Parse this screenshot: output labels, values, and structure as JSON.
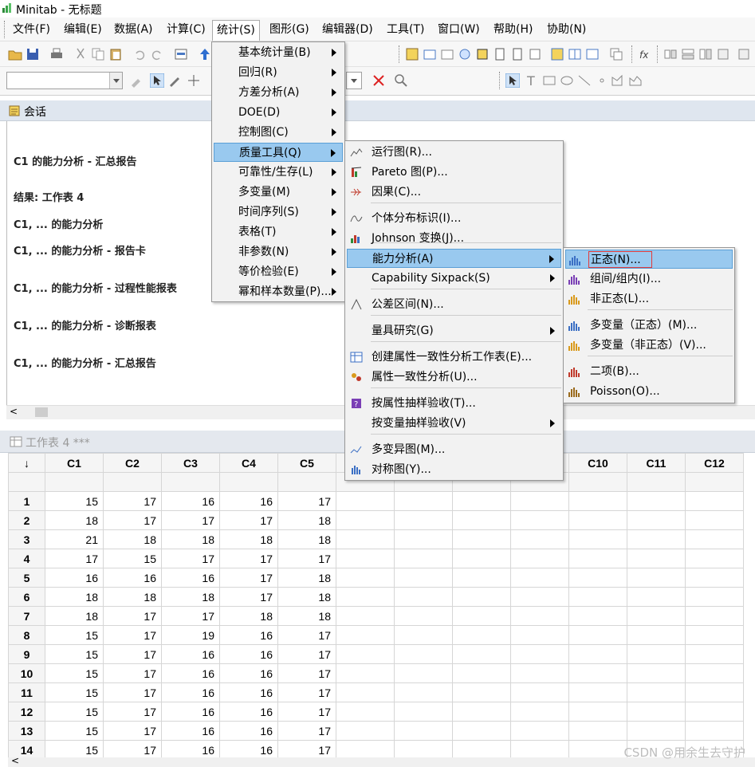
{
  "window": {
    "title": "Minitab - 无标题"
  },
  "menubar": {
    "items": [
      "文件(F)",
      "编辑(E)",
      "数据(A)",
      "计算(C)",
      "统计(S)",
      "图形(G)",
      "编辑器(D)",
      "工具(T)",
      "窗口(W)",
      "帮助(H)",
      "协助(N)"
    ],
    "active": "统计(S)"
  },
  "session": {
    "title": "会话",
    "lines": [
      "C1 的能力分析 - 汇总报告",
      "结果: 工作表 4",
      "C1, ... 的能力分析",
      "C1, ... 的能力分析 - 报告卡",
      "C1, ... 的能力分析 - 过程性能报表",
      "C1, ... 的能力分析 - 诊断报表",
      "C1, ... 的能力分析 - 汇总报告"
    ],
    "scroll_left": "<"
  },
  "worksheet": {
    "title": "工作表 4 ***",
    "sort_indicator": "↓",
    "columns": [
      "C1",
      "C2",
      "C3",
      "C4",
      "C5",
      "C6",
      "C7",
      "C8",
      "C9",
      "C10",
      "C11",
      "C12"
    ],
    "rows": [
      [
        "1",
        "15",
        "17",
        "16",
        "16",
        "17"
      ],
      [
        "2",
        "18",
        "17",
        "17",
        "17",
        "18"
      ],
      [
        "3",
        "21",
        "18",
        "18",
        "18",
        "18"
      ],
      [
        "4",
        "17",
        "15",
        "17",
        "17",
        "17"
      ],
      [
        "5",
        "16",
        "16",
        "16",
        "17",
        "18"
      ],
      [
        "6",
        "18",
        "18",
        "18",
        "17",
        "18"
      ],
      [
        "7",
        "18",
        "17",
        "17",
        "18",
        "18"
      ],
      [
        "8",
        "15",
        "17",
        "19",
        "16",
        "17"
      ],
      [
        "9",
        "15",
        "17",
        "16",
        "16",
        "17"
      ],
      [
        "10",
        "15",
        "17",
        "16",
        "16",
        "17"
      ],
      [
        "11",
        "15",
        "17",
        "16",
        "16",
        "17"
      ],
      [
        "12",
        "15",
        "17",
        "16",
        "16",
        "17"
      ],
      [
        "13",
        "15",
        "17",
        "16",
        "16",
        "17"
      ],
      [
        "14",
        "15",
        "17",
        "16",
        "16",
        "17"
      ]
    ],
    "scroll_left": "<"
  },
  "stat_menu": [
    {
      "label": "基本统计量(B)",
      "submenu": true
    },
    {
      "label": "回归(R)",
      "submenu": true
    },
    {
      "label": "方差分析(A)",
      "submenu": true
    },
    {
      "label": "DOE(D)",
      "submenu": true
    },
    {
      "label": "控制图(C)",
      "submenu": true
    },
    {
      "label": "质量工具(Q)",
      "submenu": true,
      "highlighted": true
    },
    {
      "label": "可靠性/生存(L)",
      "submenu": true
    },
    {
      "label": "多变量(M)",
      "submenu": true
    },
    {
      "label": "时间序列(S)",
      "submenu": true
    },
    {
      "label": "表格(T)",
      "submenu": true
    },
    {
      "label": "非参数(N)",
      "submenu": true
    },
    {
      "label": "等价检验(E)",
      "submenu": true
    },
    {
      "label": "幂和样本数量(P)...",
      "submenu": true
    }
  ],
  "quality_menu": [
    {
      "label": "运行图(R)...",
      "icon": "run-chart-icon"
    },
    {
      "label": "Pareto 图(P)...",
      "icon": "pareto-icon"
    },
    {
      "label": "因果(C)...",
      "icon": "fishbone-icon"
    },
    {
      "label": "个体分布标识(I)...",
      "icon": "distribution-id-icon"
    },
    {
      "label": "Johnson 变换(J)...",
      "icon": "johnson-icon"
    },
    {
      "label": "能力分析(A)",
      "submenu": true,
      "highlighted": true
    },
    {
      "label": "Capability Sixpack(S)",
      "submenu": true
    },
    {
      "label": "公差区间(N)...",
      "icon": "tolerance-icon"
    },
    {
      "label": "量具研究(G)",
      "submenu": true
    },
    {
      "label": "创建属性一致性分析工作表(E)...",
      "icon": "worksheet-icon"
    },
    {
      "label": "属性一致性分析(U)...",
      "icon": "agreement-icon"
    },
    {
      "label": "按属性抽样验收(T)...",
      "icon": "sampling-icon"
    },
    {
      "label": "按变量抽样验收(V)",
      "submenu": true
    },
    {
      "label": "多变异图(M)...",
      "icon": "multivari-icon"
    },
    {
      "label": "对称图(Y)...",
      "icon": "symmetry-icon"
    }
  ],
  "capability_menu": [
    {
      "label": "正态(N)...",
      "highlighted": true,
      "icon_color": "#3b6fc4"
    },
    {
      "label": "组间/组内(I)...",
      "icon_color": "#7a3fb5"
    },
    {
      "label": "非正态(L)...",
      "icon_color": "#d99a1c"
    },
    {
      "label": "多变量（正态）(M)...",
      "icon_color": "#3b6fc4"
    },
    {
      "label": "多变量（非正态）(V)...",
      "icon_color": "#d99a1c"
    },
    {
      "label": "二项(B)...",
      "icon_color": "#c0392b"
    },
    {
      "label": "Poisson(O)...",
      "icon_color": "#9a6a1c"
    }
  ],
  "watermark": "CSDN @用余生去守护"
}
